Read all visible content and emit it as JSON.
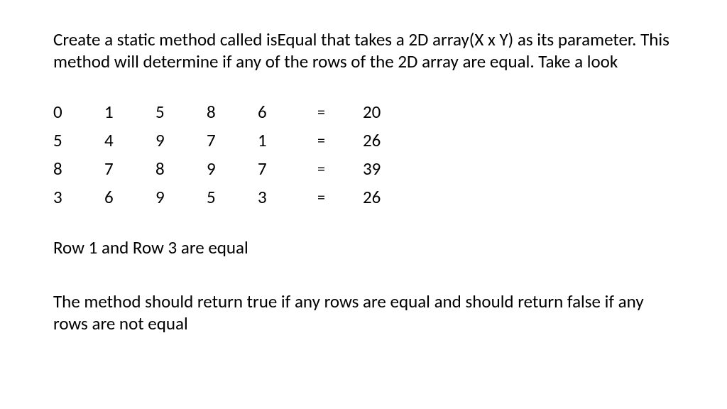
{
  "intro": "Create a static method called isEqual that takes a 2D array(X x Y) as its parameter.  This method will determine if any of the rows of the 2D array are equal.  Take a look",
  "rows": [
    {
      "cells": [
        "0",
        "1",
        "5",
        "8",
        "6"
      ],
      "eq": "=",
      "sum": "20"
    },
    {
      "cells": [
        "5",
        "4",
        "9",
        "7",
        "1"
      ],
      "eq": "=",
      "sum": "26"
    },
    {
      "cells": [
        "8",
        "7",
        "8",
        "9",
        "7"
      ],
      "eq": "=",
      "sum": "39"
    },
    {
      "cells": [
        "3",
        "6",
        "9",
        "5",
        "3"
      ],
      "eq": "=",
      "sum": "26"
    }
  ],
  "observation": "Row 1 and Row 3 are equal",
  "conclusion": "The method should return true if any rows are equal and should return false if any rows are not equal"
}
